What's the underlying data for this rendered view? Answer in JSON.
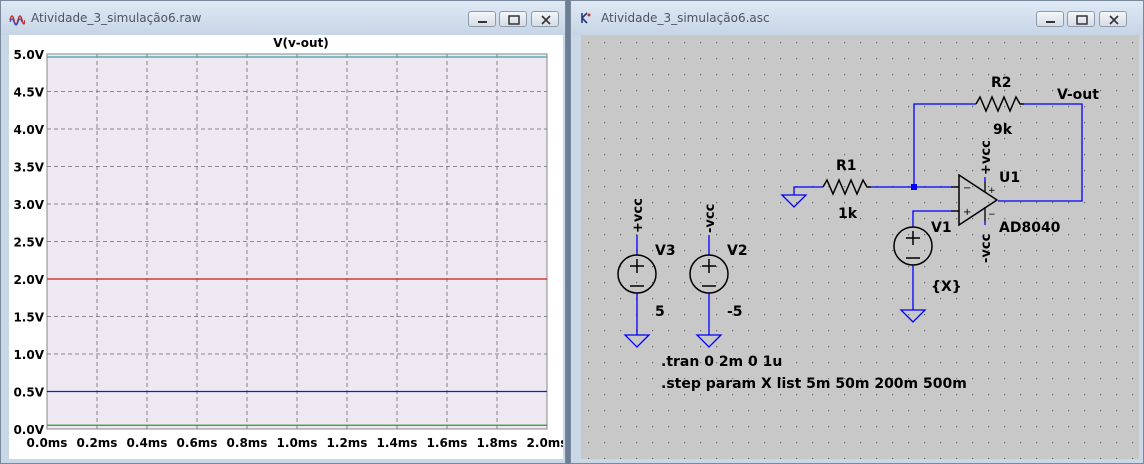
{
  "waveform_window": {
    "title": "Atividade_3_simulação6.raw",
    "plot_title": "V(v-out)"
  },
  "schematic_window": {
    "title": "Atividade_3_simulação6.asc",
    "labels": {
      "r1_name": "R1",
      "r1_value": "1k",
      "r2_name": "R2",
      "r2_value": "9k",
      "u1_name": "U1",
      "u1_model": "AD8040",
      "v1_name": "V1",
      "v1_value": "{X}",
      "v2_name": "V2",
      "v2_value": "-5",
      "v3_name": "V3",
      "v3_value": "5",
      "net_vout": "V-out",
      "net_pvcc_v3": "+vcc",
      "net_nvcc_v2": "-vcc",
      "net_pvcc_u1": "+vcc",
      "net_nvcc_u1": "-vcc",
      "directive_tran": ".tran 0 2m 0 1u",
      "directive_step": ".step param X list 5m 50m 200m 500m"
    }
  },
  "colors": {
    "plot_bg": "#ede8f1",
    "grid": "#6b6b6b",
    "schematic_bg": "#c8c8c8",
    "wire": "#0000ff"
  },
  "chart_data": {
    "type": "line",
    "title": "V(v-out)",
    "xlabel": "",
    "ylabel": "",
    "x_ticks": [
      "0.0ms",
      "0.2ms",
      "0.4ms",
      "0.6ms",
      "0.8ms",
      "1.0ms",
      "1.2ms",
      "1.4ms",
      "1.6ms",
      "1.8ms",
      "2.0ms"
    ],
    "y_ticks": [
      "0.0V",
      "0.5V",
      "1.0V",
      "1.5V",
      "2.0V",
      "2.5V",
      "3.0V",
      "3.5V",
      "4.0V",
      "4.5V",
      "5.0V"
    ],
    "xlim": [
      0,
      2.0
    ],
    "ylim": [
      0,
      5.0
    ],
    "grid": true,
    "series": [
      {
        "x": [
          0,
          2.0
        ],
        "y": [
          0.05,
          0.05
        ],
        "color": "#2a9a2a"
      },
      {
        "x": [
          0,
          2.0
        ],
        "y": [
          0.5,
          0.5
        ],
        "color": "#1a1acc"
      },
      {
        "x": [
          0,
          2.0
        ],
        "y": [
          2.0,
          2.0
        ],
        "color": "#cc1a1a"
      },
      {
        "x": [
          0,
          2.0
        ],
        "y": [
          4.96,
          4.96
        ],
        "color": "#3aa6a6"
      }
    ]
  }
}
